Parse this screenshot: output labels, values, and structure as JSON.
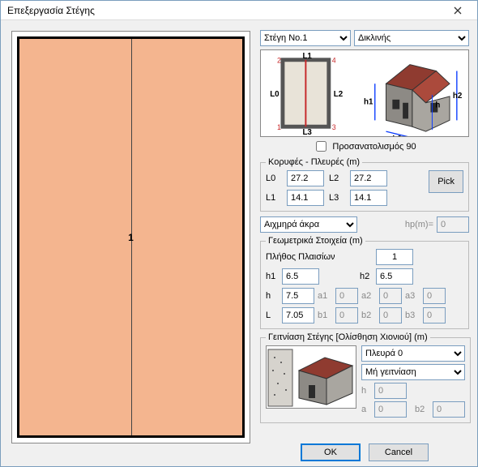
{
  "window": {
    "title": "Επεξεργασία Στέγης"
  },
  "top_selects": {
    "roof_no": "Στέγη No.1",
    "roof_type": "Δικλινής"
  },
  "diagram": {
    "L0": "L0",
    "L1": "L1",
    "L2": "L2",
    "L3": "L3",
    "c1": "1",
    "c2": "2",
    "c3": "3",
    "c4": "4",
    "h1": "h1",
    "h2": "h2",
    "h": "h",
    "L": "L",
    "Llbl0": "L0"
  },
  "orientation90": "Προσανατολισμός 90",
  "vertices": {
    "group": "Κορυφές - Πλευρές (m)",
    "L0_lbl": "L0",
    "L0_val": "27.2",
    "L1_lbl": "L1",
    "L1_val": "14.1",
    "L2_lbl": "L2",
    "L2_val": "27.2",
    "L3_lbl": "L3",
    "L3_val": "14.1",
    "pick": "Pick"
  },
  "edge_select": "Αιχμηρά άκρα",
  "hp": {
    "label": "hp(m)=",
    "val": "0"
  },
  "geom": {
    "group": "Γεωμετρικά Στοιχεία (m)",
    "frames_label": "Πλήθος Πλαισίων",
    "frames_val": "1",
    "h1_lbl": "h1",
    "h1_val": "6.5",
    "h2_lbl": "h2",
    "h2_val": "6.5",
    "h_lbl": "h",
    "h_val": "7.5",
    "a1_lbl": "a1",
    "a1_val": "0",
    "a2_lbl": "a2",
    "a2_val": "0",
    "a3_lbl": "a3",
    "a3_val": "0",
    "L_lbl": "L",
    "L_val": "7.05",
    "b1_lbl": "b1",
    "b1_val": "0",
    "b2_lbl": "b2",
    "b2_val": "0",
    "b3_lbl": "b3",
    "b3_val": "0"
  },
  "adj": {
    "group": "Γειτνίαση Στέγης [Ολίσθηση Χιονιού] (m)",
    "side_select": "Πλευρά 0",
    "mode_select": "Μή γειτνίαση",
    "h_lbl": "h",
    "h_val": "0",
    "a_lbl": "a",
    "a_val": "0",
    "b2_lbl": "b2",
    "b2_val": "0"
  },
  "preview": {
    "label": "1"
  },
  "buttons": {
    "ok": "OK",
    "cancel": "Cancel"
  }
}
